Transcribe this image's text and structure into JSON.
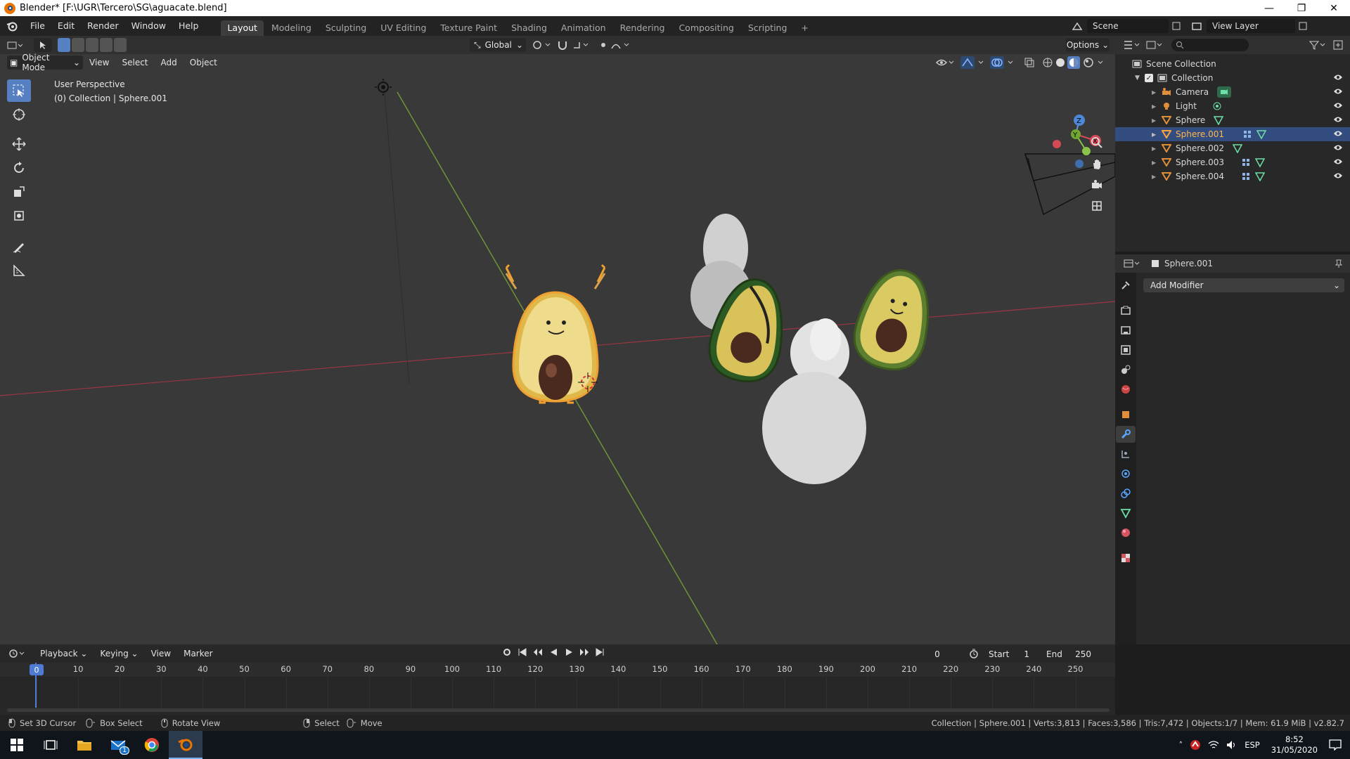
{
  "window": {
    "title": "Blender* [F:\\UGR\\Tercero\\SG\\aguacate.blend]",
    "minimize": "—",
    "maximize": "❐",
    "close": "✕"
  },
  "menu": [
    "File",
    "Edit",
    "Render",
    "Window",
    "Help"
  ],
  "workspaces": [
    "Layout",
    "Modeling",
    "Sculpting",
    "UV Editing",
    "Texture Paint",
    "Shading",
    "Animation",
    "Rendering",
    "Compositing",
    "Scripting"
  ],
  "scene": {
    "name": "Scene",
    "view_layer": "View Layer"
  },
  "viewport_header": {
    "transform_orientation": "Global",
    "options": "Options",
    "mode": "Object Mode",
    "menus": [
      "View",
      "Select",
      "Add",
      "Object"
    ]
  },
  "viewport": {
    "perspective": "User Perspective",
    "collection_info": "(0) Collection | Sphere.001",
    "gizmo": {
      "z": "Z",
      "y": "Y",
      "x": "X"
    }
  },
  "outliner": {
    "root": "Scene Collection",
    "collection": "Collection",
    "items": [
      {
        "name": "Camera",
        "type": "camera",
        "selected": false
      },
      {
        "name": "Light",
        "type": "light",
        "selected": false
      },
      {
        "name": "Sphere",
        "type": "mesh",
        "selected": false
      },
      {
        "name": "Sphere.001",
        "type": "mesh",
        "selected": true
      },
      {
        "name": "Sphere.002",
        "type": "mesh",
        "selected": false
      },
      {
        "name": "Sphere.003",
        "type": "mesh",
        "selected": false
      },
      {
        "name": "Sphere.004",
        "type": "mesh",
        "selected": false
      }
    ]
  },
  "properties": {
    "object_name": "Sphere.001",
    "add_modifier": "Add Modifier"
  },
  "timeline": {
    "menus": [
      "Playback",
      "Keying",
      "View",
      "Marker"
    ],
    "current_frame": "0",
    "start_label": "Start",
    "start": "1",
    "end_label": "End",
    "end": "250",
    "ruler": [
      "0",
      "10",
      "20",
      "30",
      "40",
      "50",
      "60",
      "70",
      "80",
      "90",
      "100",
      "110",
      "120",
      "130",
      "140",
      "150",
      "160",
      "170",
      "180",
      "190",
      "200",
      "210",
      "220",
      "230",
      "240",
      "250"
    ]
  },
  "statusbar": {
    "set_cursor": "Set 3D Cursor",
    "box_select": "Box Select",
    "rotate_view": "Rotate View",
    "select": "Select",
    "move": "Move",
    "stats": "Collection | Sphere.001 | Verts:3,813 | Faces:3,586 | Tris:7,472 | Objects:1/7 | Mem: 61.9 MiB | v2.82.7"
  },
  "taskbar": {
    "language": "ESP",
    "time": "8:52",
    "date": "31/05/2020",
    "mail_badge": "1"
  },
  "colors": {
    "accent": "#5680c2",
    "selection_row": "#334d80",
    "active_tab": "#3d3d3d",
    "x_axis": "#b2363f",
    "y_axis": "#80b33d"
  }
}
